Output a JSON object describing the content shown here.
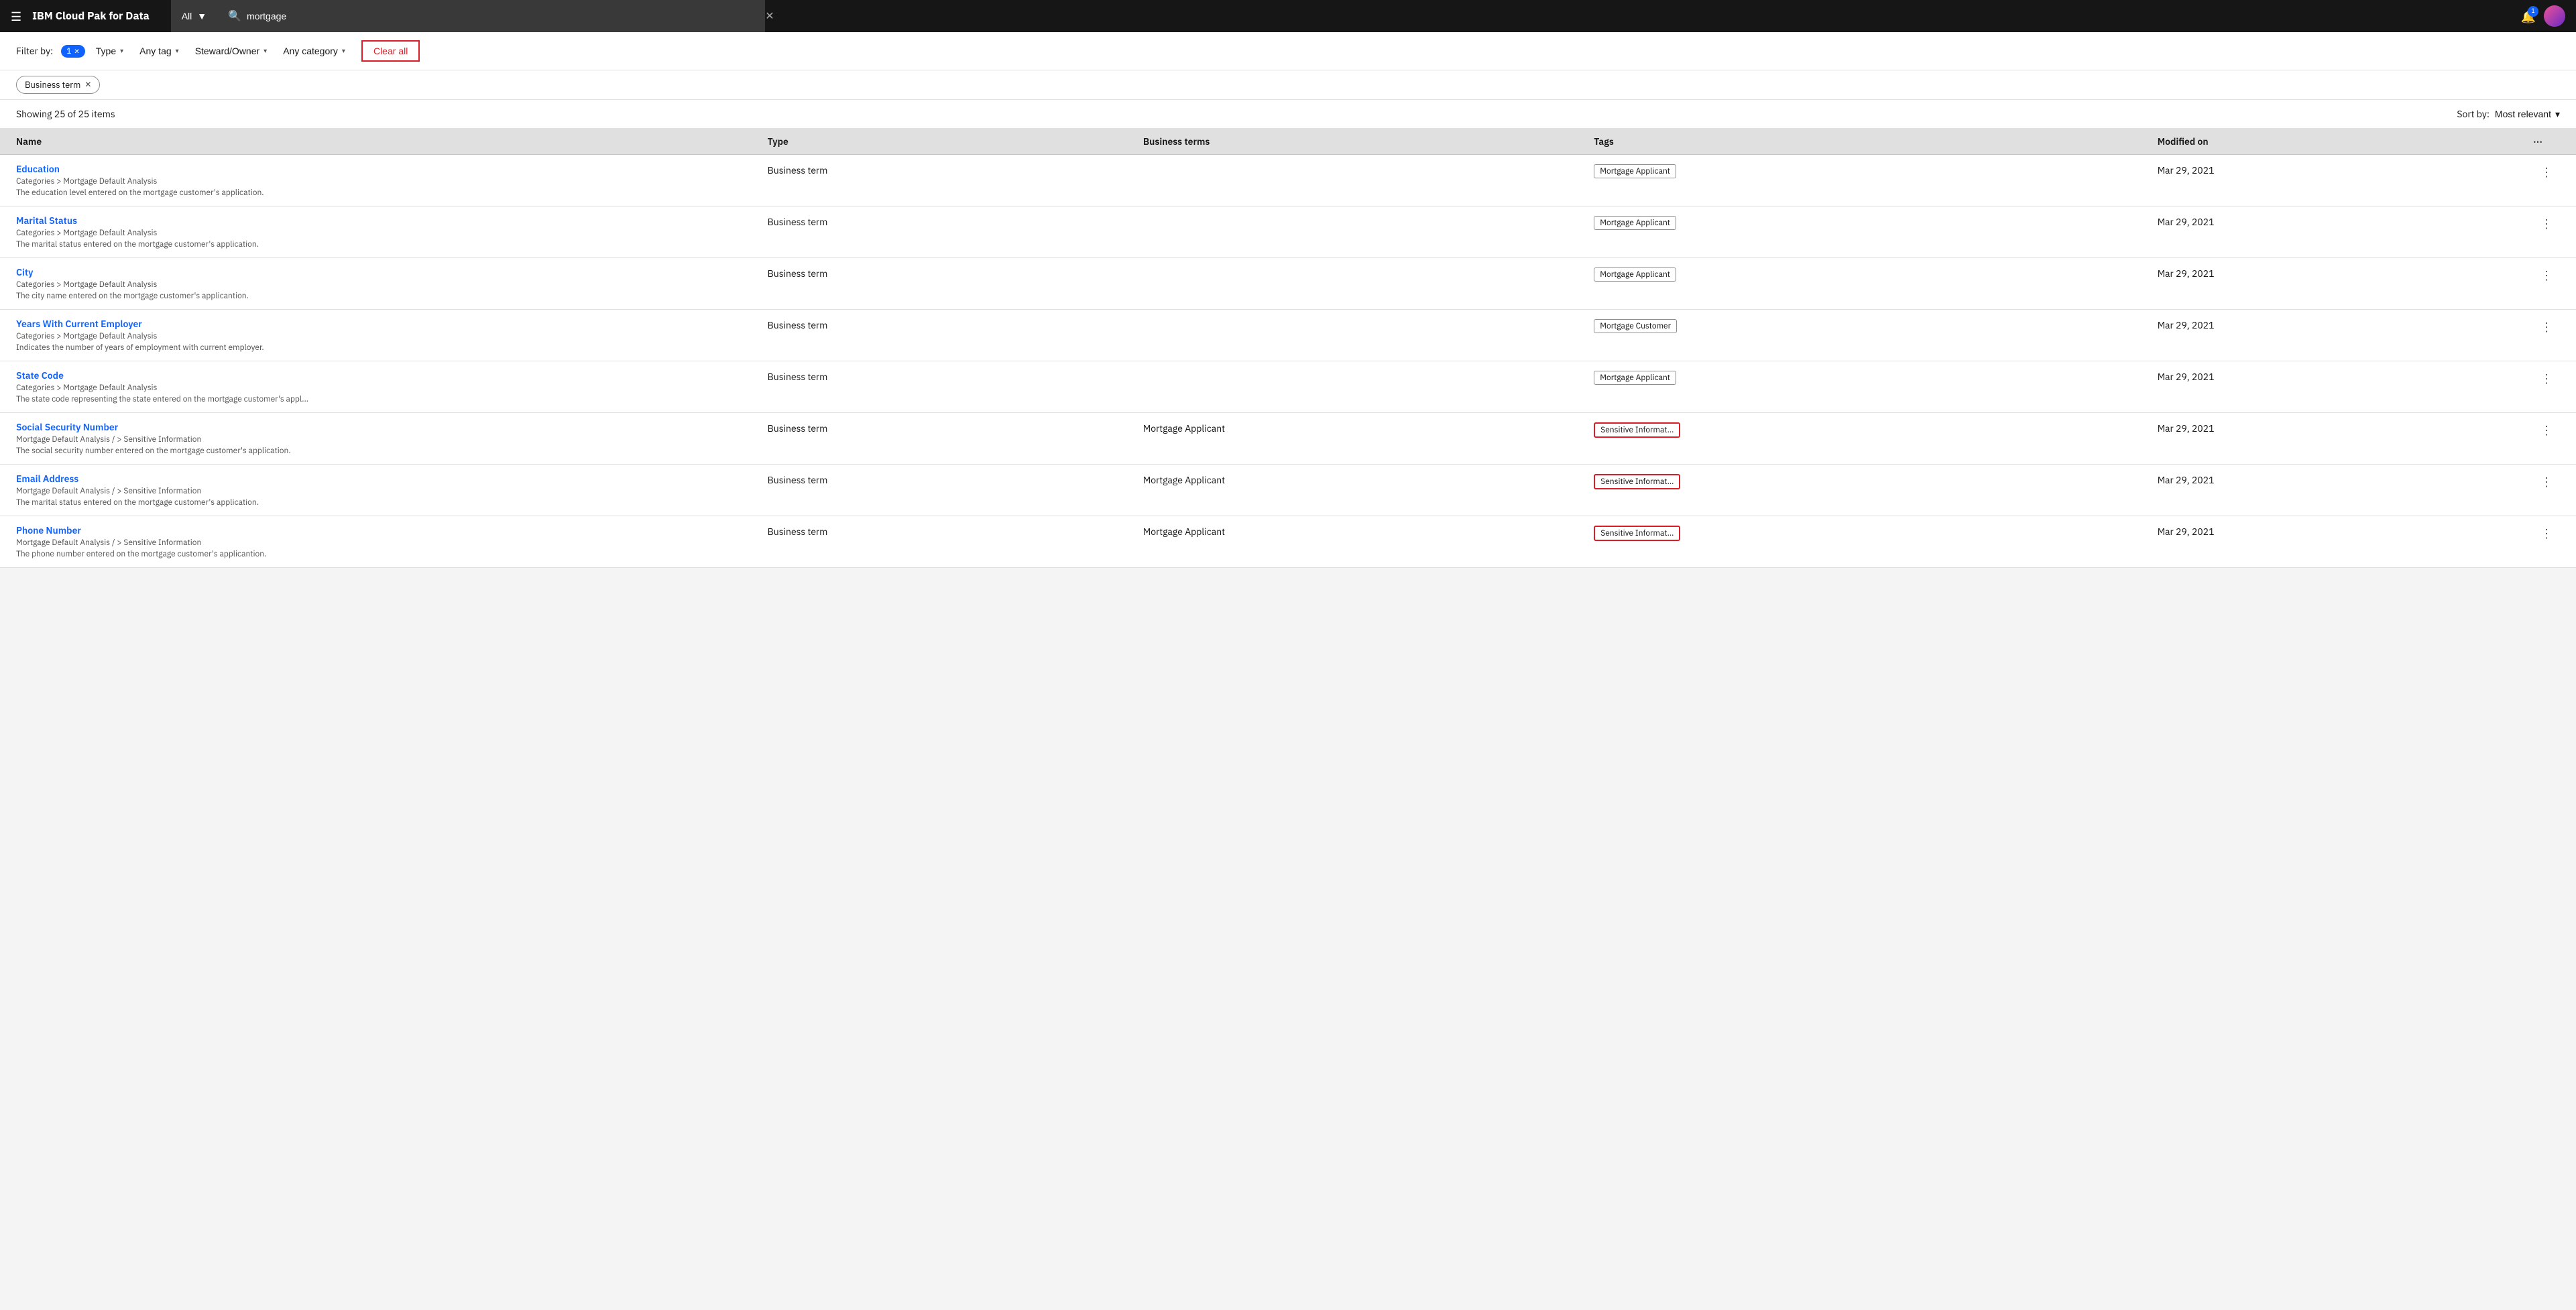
{
  "topnav": {
    "menu_label": "☰",
    "logo_ibm": "IBM",
    "logo_product": " Cloud Pak for Data",
    "scope_label": "All",
    "scope_chevron": "▼",
    "search_value": "mortgage",
    "close_icon": "✕",
    "notification_count": "1",
    "bell_icon": "🔔"
  },
  "filter_bar": {
    "label": "Filter by:",
    "badge_count": "1",
    "type_label": "Type",
    "type_chevron": "▾",
    "any_tag_label": "Any tag",
    "any_tag_chevron": "▾",
    "steward_label": "Steward/Owner",
    "steward_chevron": "▾",
    "any_category_label": "Any category",
    "any_category_chevron": "▾",
    "clear_all_label": "Clear all"
  },
  "active_filters": {
    "business_term_label": "Business term",
    "close_icon": "✕"
  },
  "results_bar": {
    "showing_text": "Showing 25 of 25 items",
    "sort_label": "Sort by:",
    "sort_value": "Most relevant",
    "sort_chevron": "▾"
  },
  "table": {
    "headers": {
      "name": "Name",
      "type": "Type",
      "business_terms": "Business terms",
      "tags": "Tags",
      "modified_on": "Modified on",
      "more_icon": "⋯"
    },
    "rows": [
      {
        "title": "Education",
        "path": "Categories > Mortgage Default Analysis",
        "desc": "The education level entered on the mortgage customer's application.",
        "type": "Business term",
        "business_terms": "",
        "tags": [
          {
            "label": "Mortgage Applicant",
            "highlighted": false
          }
        ],
        "modified": "Mar 29, 2021"
      },
      {
        "title": "Marital Status",
        "path": "Categories > Mortgage Default Analysis",
        "desc": "The marital status entered on the mortgage customer's application.",
        "type": "Business term",
        "business_terms": "",
        "tags": [
          {
            "label": "Mortgage Applicant",
            "highlighted": false
          }
        ],
        "modified": "Mar 29, 2021"
      },
      {
        "title": "City",
        "path": "Categories > Mortgage Default Analysis",
        "desc": "The city name entered on the mortgage customer's applicantion.",
        "type": "Business term",
        "business_terms": "",
        "tags": [
          {
            "label": "Mortgage Applicant",
            "highlighted": false
          }
        ],
        "modified": "Mar 29, 2021"
      },
      {
        "title": "Years With Current Employer",
        "path": "Categories > Mortgage Default Analysis",
        "desc": "Indicates the number of years of employment with current employer.",
        "type": "Business term",
        "business_terms": "",
        "tags": [
          {
            "label": "Mortgage Customer",
            "highlighted": false
          }
        ],
        "modified": "Mar 29, 2021"
      },
      {
        "title": "State Code",
        "path": "Categories > Mortgage Default Analysis",
        "desc": "The state code representing the state entered on the mortgage customer's appl...",
        "type": "Business term",
        "business_terms": "",
        "tags": [
          {
            "label": "Mortgage Applicant",
            "highlighted": false
          }
        ],
        "modified": "Mar 29, 2021"
      },
      {
        "title": "Social Security Number",
        "path": "Mortgage Default Analysis / > Sensitive Information",
        "desc": "The social security number entered on the mortgage customer's application.",
        "type": "Business term",
        "business_terms": "Mortgage Applicant",
        "tags": [
          {
            "label": "Sensitive Informat...",
            "highlighted": true
          }
        ],
        "modified": "Mar 29, 2021"
      },
      {
        "title": "Email Address",
        "path": "Mortgage Default Analysis / > Sensitive Information",
        "desc": "The marital status entered on the mortgage customer's application.",
        "type": "Business term",
        "business_terms": "Mortgage Applicant",
        "tags": [
          {
            "label": "Sensitive Informat...",
            "highlighted": true
          }
        ],
        "modified": "Mar 29, 2021"
      },
      {
        "title": "Phone Number",
        "path": "Mortgage Default Analysis / > Sensitive Information",
        "desc": "The phone number entered on the mortgage customer's applicantion.",
        "type": "Business term",
        "business_terms": "Mortgage Applicant",
        "tags": [
          {
            "label": "Sensitive Informat...",
            "highlighted": true
          }
        ],
        "modified": "Mar 29, 2021"
      }
    ]
  }
}
